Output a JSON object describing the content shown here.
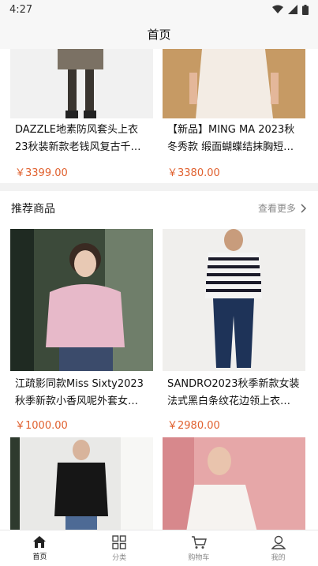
{
  "status": {
    "time": "4:27"
  },
  "nav": {
    "title": "首页"
  },
  "top_products": [
    {
      "name": "DAZZLE地素防风套头上衣23秋装新款老钱风复古千…",
      "price": "￥3399.00"
    },
    {
      "name": "【新品】MING MA 2023秋冬秀款 缎面蝴蝶结抹胸短…",
      "price": "￥3380.00"
    }
  ],
  "recommend": {
    "title": "推荐商品",
    "more": "查看更多",
    "items": [
      {
        "name": "江疏影同款Miss Sixty2023秋季新款小香风呢外套女…",
        "price": "￥1000.00"
      },
      {
        "name": "SANDRO2023秋季新款女装法式黑白条纹花边领上衣…",
        "price": "￥2980.00"
      }
    ]
  },
  "tabs": [
    {
      "label": "首页",
      "icon": "home-icon"
    },
    {
      "label": "分类",
      "icon": "category-grid-icon"
    },
    {
      "label": "购物车",
      "icon": "cart-icon"
    },
    {
      "label": "我的",
      "icon": "user-icon"
    }
  ],
  "colors": {
    "price": "#e0602e",
    "background": "#f4f4f4",
    "active_tab": "#111111"
  }
}
